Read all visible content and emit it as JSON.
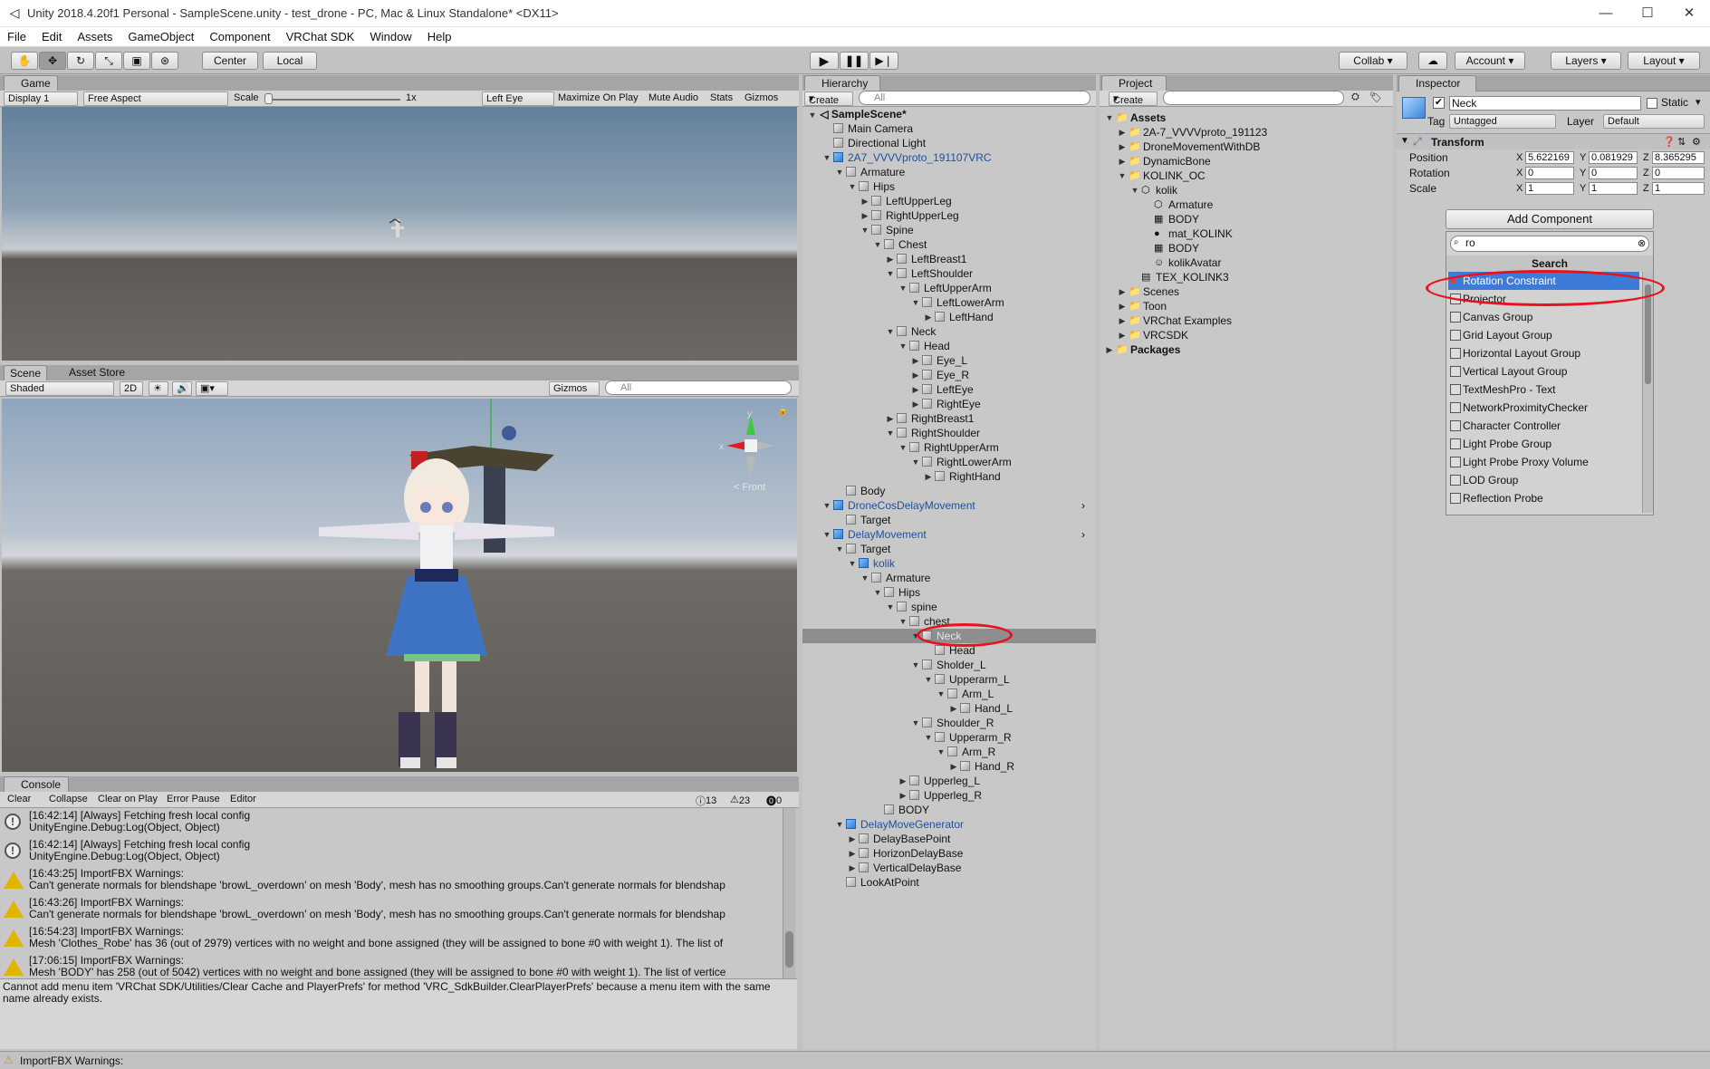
{
  "window": {
    "title": "Unity 2018.4.20f1 Personal - SampleScene.unity - test_drone - PC, Mac & Linux Standalone* <DX11>"
  },
  "menu": [
    "File",
    "Edit",
    "Assets",
    "GameObject",
    "Component",
    "VRChat SDK",
    "Window",
    "Help"
  ],
  "toolbar": {
    "center": "Center",
    "local": "Local",
    "collab": "Collab",
    "account": "Account",
    "layers": "Layers",
    "layout": "Layout"
  },
  "game": {
    "tab": "Game",
    "display": "Display 1",
    "aspect": "Free Aspect",
    "scale_label": "Scale",
    "scale_value": "1x",
    "eye": "Left Eye",
    "maximize": "Maximize On Play",
    "mute": "Mute Audio",
    "stats": "Stats",
    "gizmos": "Gizmos"
  },
  "scene": {
    "tab": "Scene",
    "store_tab": "Asset Store",
    "shading": "Shaded",
    "mode2d": "2D",
    "gizmos": "Gizmos",
    "search_placeholder": "All",
    "front": "Front",
    "axis_y": "y",
    "axis_x": "x"
  },
  "hierarchy": {
    "tab": "Hierarchy",
    "create": "Create",
    "search_placeholder": "All",
    "scene": "SampleScene*",
    "items": [
      {
        "label": "Main Camera",
        "d": 0,
        "t": ""
      },
      {
        "label": "Directional Light",
        "d": 0,
        "t": ""
      },
      {
        "label": "2A7_VVVVproto_191107VRC",
        "d": 0,
        "t": "open",
        "blue": true
      },
      {
        "label": "Armature",
        "d": 1,
        "t": "open"
      },
      {
        "label": "Hips",
        "d": 2,
        "t": "open"
      },
      {
        "label": "LeftUpperLeg",
        "d": 3,
        "t": "closed"
      },
      {
        "label": "RightUpperLeg",
        "d": 3,
        "t": "closed"
      },
      {
        "label": "Spine",
        "d": 3,
        "t": "open"
      },
      {
        "label": "Chest",
        "d": 4,
        "t": "open"
      },
      {
        "label": "LeftBreast1",
        "d": 5,
        "t": "closed"
      },
      {
        "label": "LeftShoulder",
        "d": 5,
        "t": "open"
      },
      {
        "label": "LeftUpperArm",
        "d": 6,
        "t": "open"
      },
      {
        "label": "LeftLowerArm",
        "d": 7,
        "t": "open"
      },
      {
        "label": "LeftHand",
        "d": 8,
        "t": "closed"
      },
      {
        "label": "Neck",
        "d": 5,
        "t": "open"
      },
      {
        "label": "Head",
        "d": 6,
        "t": "open"
      },
      {
        "label": "Eye_L",
        "d": 7,
        "t": "closed"
      },
      {
        "label": "Eye_R",
        "d": 7,
        "t": "closed"
      },
      {
        "label": "LeftEye",
        "d": 7,
        "t": "closed"
      },
      {
        "label": "RightEye",
        "d": 7,
        "t": "closed"
      },
      {
        "label": "RightBreast1",
        "d": 5,
        "t": "closed"
      },
      {
        "label": "RightShoulder",
        "d": 5,
        "t": "open"
      },
      {
        "label": "RightUpperArm",
        "d": 6,
        "t": "open"
      },
      {
        "label": "RightLowerArm",
        "d": 7,
        "t": "open"
      },
      {
        "label": "RightHand",
        "d": 8,
        "t": "closed"
      },
      {
        "label": "Body",
        "d": 1,
        "t": ""
      },
      {
        "label": "DroneCosDelayMovement",
        "d": 0,
        "t": "open",
        "blue": true
      },
      {
        "label": "Target",
        "d": 1,
        "t": ""
      },
      {
        "label": "DelayMovement",
        "d": 0,
        "t": "open",
        "blue": true
      },
      {
        "label": "Target",
        "d": 1,
        "t": "open"
      },
      {
        "label": "kolik",
        "d": 2,
        "t": "open",
        "blue": true
      },
      {
        "label": "Armature",
        "d": 3,
        "t": "open"
      },
      {
        "label": "Hips",
        "d": 4,
        "t": "open"
      },
      {
        "label": "spine",
        "d": 5,
        "t": "open"
      },
      {
        "label": "chest",
        "d": 6,
        "t": "open"
      },
      {
        "label": "Neck",
        "d": 7,
        "t": "open",
        "sel": true
      },
      {
        "label": "Head",
        "d": 8,
        "t": ""
      },
      {
        "label": "Sholder_L",
        "d": 7,
        "t": "open"
      },
      {
        "label": "Upperarm_L",
        "d": 8,
        "t": "open"
      },
      {
        "label": "Arm_L",
        "d": 9,
        "t": "open"
      },
      {
        "label": "Hand_L",
        "d": 10,
        "t": "closed"
      },
      {
        "label": "Shoulder_R",
        "d": 7,
        "t": "open"
      },
      {
        "label": "Upperarm_R",
        "d": 8,
        "t": "open"
      },
      {
        "label": "Arm_R",
        "d": 9,
        "t": "open"
      },
      {
        "label": "Hand_R",
        "d": 10,
        "t": "closed"
      },
      {
        "label": "Upperleg_L",
        "d": 6,
        "t": "closed"
      },
      {
        "label": "Upperleg_R",
        "d": 6,
        "t": "closed"
      },
      {
        "label": "BODY",
        "d": 4,
        "t": ""
      },
      {
        "label": "DelayMoveGenerator",
        "d": 1,
        "t": "open",
        "blue": true
      },
      {
        "label": "DelayBasePoint",
        "d": 2,
        "t": "closed"
      },
      {
        "label": "HorizonDelayBase",
        "d": 2,
        "t": "closed"
      },
      {
        "label": "VerticalDelayBase",
        "d": 2,
        "t": "closed"
      },
      {
        "label": "LookAtPoint",
        "d": 1,
        "t": ""
      }
    ]
  },
  "project": {
    "tab": "Project",
    "create": "Create",
    "items": [
      {
        "label": "Assets",
        "d": 0,
        "t": "open",
        "kind": "folder",
        "bold": true
      },
      {
        "label": "2A-7_VVVVproto_191123",
        "d": 1,
        "t": "closed",
        "kind": "folder"
      },
      {
        "label": "DroneMovementWithDB",
        "d": 1,
        "t": "closed",
        "kind": "folder"
      },
      {
        "label": "DynamicBone",
        "d": 1,
        "t": "closed",
        "kind": "folder"
      },
      {
        "label": "KOLINK_OC",
        "d": 1,
        "t": "open",
        "kind": "folder"
      },
      {
        "label": "kolik",
        "d": 2,
        "t": "open",
        "kind": "model"
      },
      {
        "label": "Armature",
        "d": 3,
        "t": "",
        "kind": "model"
      },
      {
        "label": "BODY",
        "d": 3,
        "t": "",
        "kind": "mesh"
      },
      {
        "label": "mat_KOLINK",
        "d": 3,
        "t": "",
        "kind": "mat"
      },
      {
        "label": "BODY",
        "d": 3,
        "t": "",
        "kind": "grid"
      },
      {
        "label": "kolikAvatar",
        "d": 3,
        "t": "",
        "kind": "avatar"
      },
      {
        "label": "TEX_KOLINK3",
        "d": 2,
        "t": "",
        "kind": "tex"
      },
      {
        "label": "Scenes",
        "d": 1,
        "t": "closed",
        "kind": "folder"
      },
      {
        "label": "Toon",
        "d": 1,
        "t": "closed",
        "kind": "folder"
      },
      {
        "label": "VRChat Examples",
        "d": 1,
        "t": "closed",
        "kind": "folder"
      },
      {
        "label": "VRCSDK",
        "d": 1,
        "t": "closed",
        "kind": "folder"
      },
      {
        "label": "Packages",
        "d": 0,
        "t": "closed",
        "kind": "folder",
        "bold": true
      }
    ]
  },
  "inspector": {
    "tab": "Inspector",
    "name": "Neck",
    "static_label": "Static",
    "tag_label": "Tag",
    "tag_value": "Untagged",
    "layer_label": "Layer",
    "layer_value": "Default",
    "transform": "Transform",
    "position_label": "Position",
    "rotation_label": "Rotation",
    "scale_label": "Scale",
    "pos": [
      "5.622169",
      "0.081929",
      "8.365295"
    ],
    "rot": [
      "0",
      "0",
      "0"
    ],
    "scl": [
      "1",
      "1",
      "1"
    ],
    "add_component": "Add Component",
    "search_value": "ro",
    "search_header": "Search",
    "results": [
      "Rotation Constraint",
      "Projector",
      "Canvas Group",
      "Grid Layout Group",
      "Horizontal Layout Group",
      "Vertical Layout Group",
      "TextMeshPro - Text",
      "NetworkProximityChecker",
      "Character Controller",
      "Light Probe Group",
      "Light Probe Proxy Volume",
      "LOD Group",
      "Reflection Probe"
    ]
  },
  "console": {
    "tab": "Console",
    "clear": "Clear",
    "collapse": "Collapse",
    "clear_on_play": "Clear on Play",
    "error_pause": "Error Pause",
    "editor": "Editor",
    "count_info": "13",
    "count_warn": "23",
    "count_err": "0",
    "lines": [
      {
        "kind": "info",
        "a": "[16:42:14] [Always] Fetching fresh local config",
        "b": "UnityEngine.Debug:Log(Object, Object)"
      },
      {
        "kind": "info",
        "a": "[16:42:14] [Always] Fetching fresh local config",
        "b": "UnityEngine.Debug:Log(Object, Object)"
      },
      {
        "kind": "warn",
        "a": "[16:43:25] ImportFBX Warnings:",
        "b": "Can't generate normals for blendshape 'browL_overdown' on mesh 'Body', mesh has no smoothing groups.Can't generate normals for blendshap"
      },
      {
        "kind": "warn",
        "a": "[16:43:26] ImportFBX Warnings:",
        "b": "Can't generate normals for blendshape 'browL_overdown' on mesh 'Body', mesh has no smoothing groups.Can't generate normals for blendshap"
      },
      {
        "kind": "warn",
        "a": "[16:54:23] ImportFBX Warnings:",
        "b": "Mesh 'Clothes_Robe' has 36 (out of 2979) vertices with no weight and bone assigned (they will be assigned to bone #0 with weight 1). The list of"
      },
      {
        "kind": "warn",
        "a": "[17:06:15] ImportFBX Warnings:",
        "b": "Mesh 'BODY' has 258 (out of 5042) vertices with no weight and bone assigned (they will be assigned to bone #0 with weight 1). The list of vertice"
      }
    ],
    "detail": "Cannot add menu item 'VRChat SDK/Utilities/Clear Cache and PlayerPrefs' for method 'VRC_SdkBuilder.ClearPlayerPrefs' because a menu item with the same name already exists."
  },
  "statusbar": {
    "text": "ImportFBX Warnings:"
  },
  "colors": {
    "selection": "#3d7bd9",
    "annotation": "#e8121e",
    "panel_bg": "#c2c2c2"
  }
}
